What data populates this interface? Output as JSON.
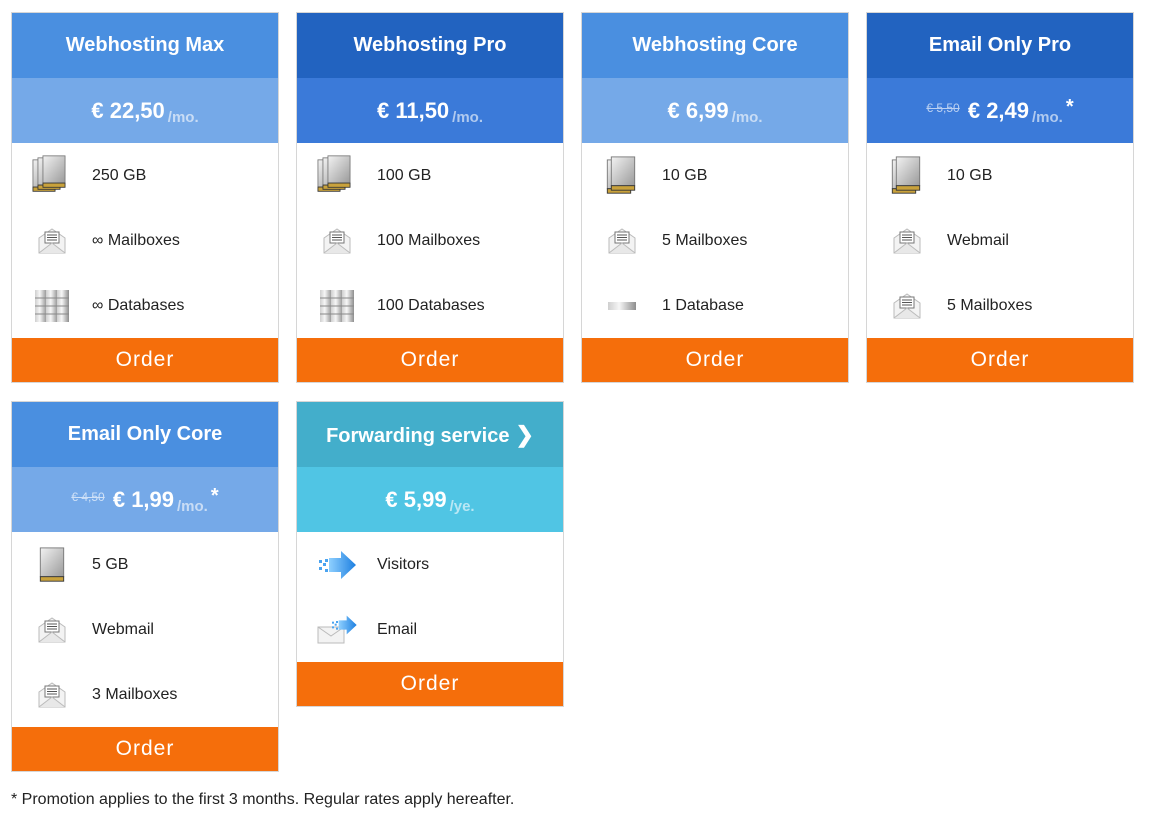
{
  "colors": {
    "order_button": "#f56e0b",
    "title_light_blue": "#4a8fe0",
    "price_light_blue": "#75a9e8",
    "title_dark_blue": "#2263c0",
    "price_dark_blue": "#3b7ad9",
    "title_teal": "#43aecb",
    "price_teal": "#50c5e4"
  },
  "plans": [
    {
      "title": "Webhosting Max",
      "price": "€ 22,50",
      "unit": "/mo.",
      "features": [
        {
          "icon": "hard-drives-stack-icon",
          "label": "250 GB"
        },
        {
          "icon": "envelope-icon",
          "label": "∞ Mailboxes"
        },
        {
          "icon": "database-stack-icon",
          "label": "∞ Databases"
        }
      ],
      "order_label": "Order"
    },
    {
      "title": "Webhosting Pro",
      "price": "€ 11,50",
      "unit": "/mo.",
      "features": [
        {
          "icon": "hard-drives-stack-icon",
          "label": "100 GB"
        },
        {
          "icon": "envelope-icon",
          "label": "100 Mailboxes"
        },
        {
          "icon": "database-stack-icon",
          "label": "100 Databases"
        }
      ],
      "order_label": "Order"
    },
    {
      "title": "Webhosting Core",
      "price": "€ 6,99",
      "unit": "/mo.",
      "features": [
        {
          "icon": "hard-drives-icon",
          "label": "10 GB"
        },
        {
          "icon": "envelope-icon",
          "label": "5 Mailboxes"
        },
        {
          "icon": "database-icon",
          "label": "1 Database"
        }
      ],
      "order_label": "Order"
    },
    {
      "title": "Email Only Pro",
      "old_price": "€ 5,50",
      "price": "€ 2,49",
      "unit": "/mo.",
      "promo_mark": "*",
      "features": [
        {
          "icon": "hard-drives-icon",
          "label": "10 GB"
        },
        {
          "icon": "envelope-icon",
          "label": "Webmail"
        },
        {
          "icon": "envelope-icon",
          "label": "5 Mailboxes"
        }
      ],
      "order_label": "Order"
    },
    {
      "title": "Email Only Core",
      "old_price": "€ 4,50",
      "price": "€ 1,99",
      "unit": "/mo.",
      "promo_mark": "*",
      "features": [
        {
          "icon": "hard-drive-icon",
          "label": "5 GB"
        },
        {
          "icon": "envelope-icon",
          "label": "Webmail"
        },
        {
          "icon": "envelope-icon",
          "label": "3 Mailboxes"
        }
      ],
      "order_label": "Order"
    },
    {
      "title": "Forwarding service",
      "title_icon": "chevron-right-icon",
      "price": "€ 5,99",
      "unit": "/ye.",
      "features": [
        {
          "icon": "forward-arrow-icon",
          "label": "Visitors"
        },
        {
          "icon": "email-forward-icon",
          "label": "Email"
        }
      ],
      "order_label": "Order"
    }
  ],
  "footnote": "* Promotion applies to the first 3 months. Regular rates apply hereafter."
}
